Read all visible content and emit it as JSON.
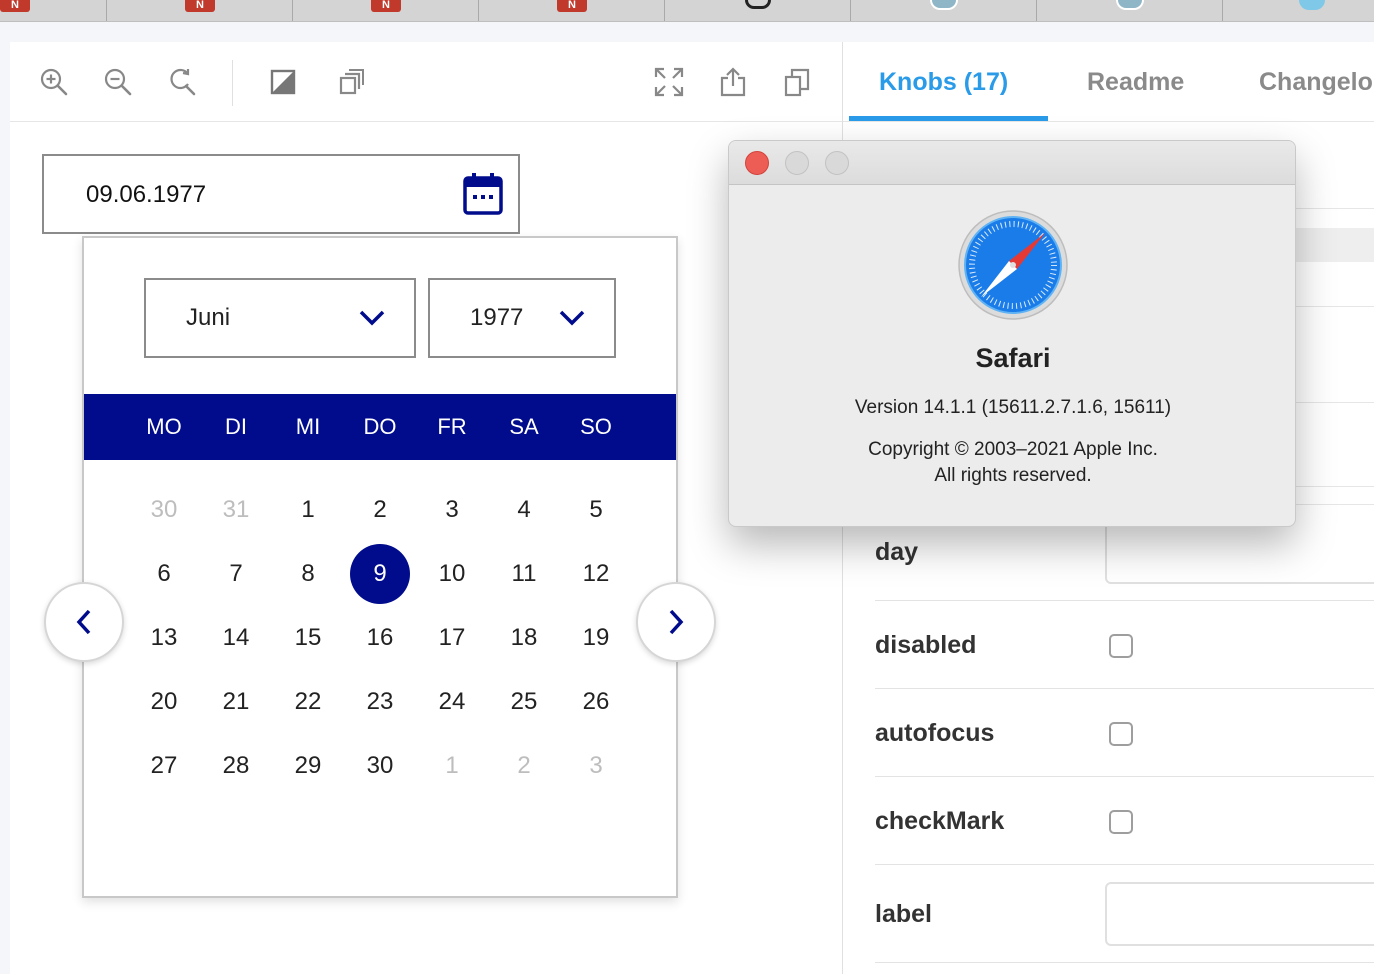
{
  "colors": {
    "accent": "#2a9be8",
    "calendar_primary": "#000c8c",
    "muted_day": "#bdbdbd"
  },
  "toolbar": {
    "icons": [
      "zoom-in-icon",
      "zoom-out-icon",
      "reset-zoom-icon",
      "background-icon",
      "grid-icon",
      "fullscreen-icon",
      "share-icon",
      "copy-icon"
    ]
  },
  "date_field": {
    "value": "09.06.1977",
    "icon": "calendar-icon"
  },
  "calendar": {
    "month": "Juni",
    "year": "1977",
    "weekdays": [
      "MO",
      "DI",
      "MI",
      "DO",
      "FR",
      "SA",
      "SO"
    ],
    "weeks": [
      [
        {
          "d": "30",
          "muted": true
        },
        {
          "d": "31",
          "muted": true
        },
        {
          "d": "1"
        },
        {
          "d": "2"
        },
        {
          "d": "3"
        },
        {
          "d": "4"
        },
        {
          "d": "5"
        }
      ],
      [
        {
          "d": "6"
        },
        {
          "d": "7"
        },
        {
          "d": "8"
        },
        {
          "d": "9",
          "selected": true
        },
        {
          "d": "10"
        },
        {
          "d": "11"
        },
        {
          "d": "12"
        }
      ],
      [
        {
          "d": "13"
        },
        {
          "d": "14"
        },
        {
          "d": "15"
        },
        {
          "d": "16"
        },
        {
          "d": "17"
        },
        {
          "d": "18"
        },
        {
          "d": "19"
        }
      ],
      [
        {
          "d": "20"
        },
        {
          "d": "21"
        },
        {
          "d": "22"
        },
        {
          "d": "23"
        },
        {
          "d": "24"
        },
        {
          "d": "25"
        },
        {
          "d": "26"
        }
      ],
      [
        {
          "d": "27"
        },
        {
          "d": "28"
        },
        {
          "d": "29"
        },
        {
          "d": "30"
        },
        {
          "d": "1",
          "muted": true
        },
        {
          "d": "2",
          "muted": true
        },
        {
          "d": "3",
          "muted": true
        }
      ]
    ]
  },
  "addon_tabs": [
    "Knobs (17)",
    "Readme",
    "Changelo"
  ],
  "knobs": {
    "day": "day",
    "disabled": "disabled",
    "autofocus": "autofocus",
    "checkMark": "checkMark",
    "label": "label"
  },
  "about_dialog": {
    "app_name": "Safari",
    "version": "Version 14.1.1 (15611.2.7.1.6, 15611)",
    "copyright_line1": "Copyright © 2003–2021 Apple Inc.",
    "copyright_line2": "All rights reserved."
  }
}
